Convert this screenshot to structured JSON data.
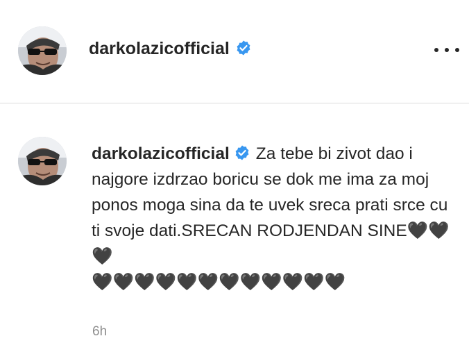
{
  "post": {
    "username": "darkolazicofficial",
    "verified_icon": "verified-badge-icon",
    "more_icon": "more-options-icon"
  },
  "comment": {
    "username": "darkolazicofficial",
    "text": "Za tebe bi zivot dao i najgore izdrzao boricu se dok me ima za moj ponos moga sina da te uvek sreca prati srce cu ti svoje dati.SRECAN RODJENDAN SINE",
    "hearts_line1": "🖤🖤🖤",
    "hearts_line2": "🖤🖤🖤🖤🖤🖤🖤🖤🖤🖤🖤🖤",
    "timestamp": "6h"
  },
  "colors": {
    "verified_blue": "#3897f0",
    "text": "#262626",
    "muted": "#8e8e8e",
    "divider": "#dbdbdb"
  }
}
